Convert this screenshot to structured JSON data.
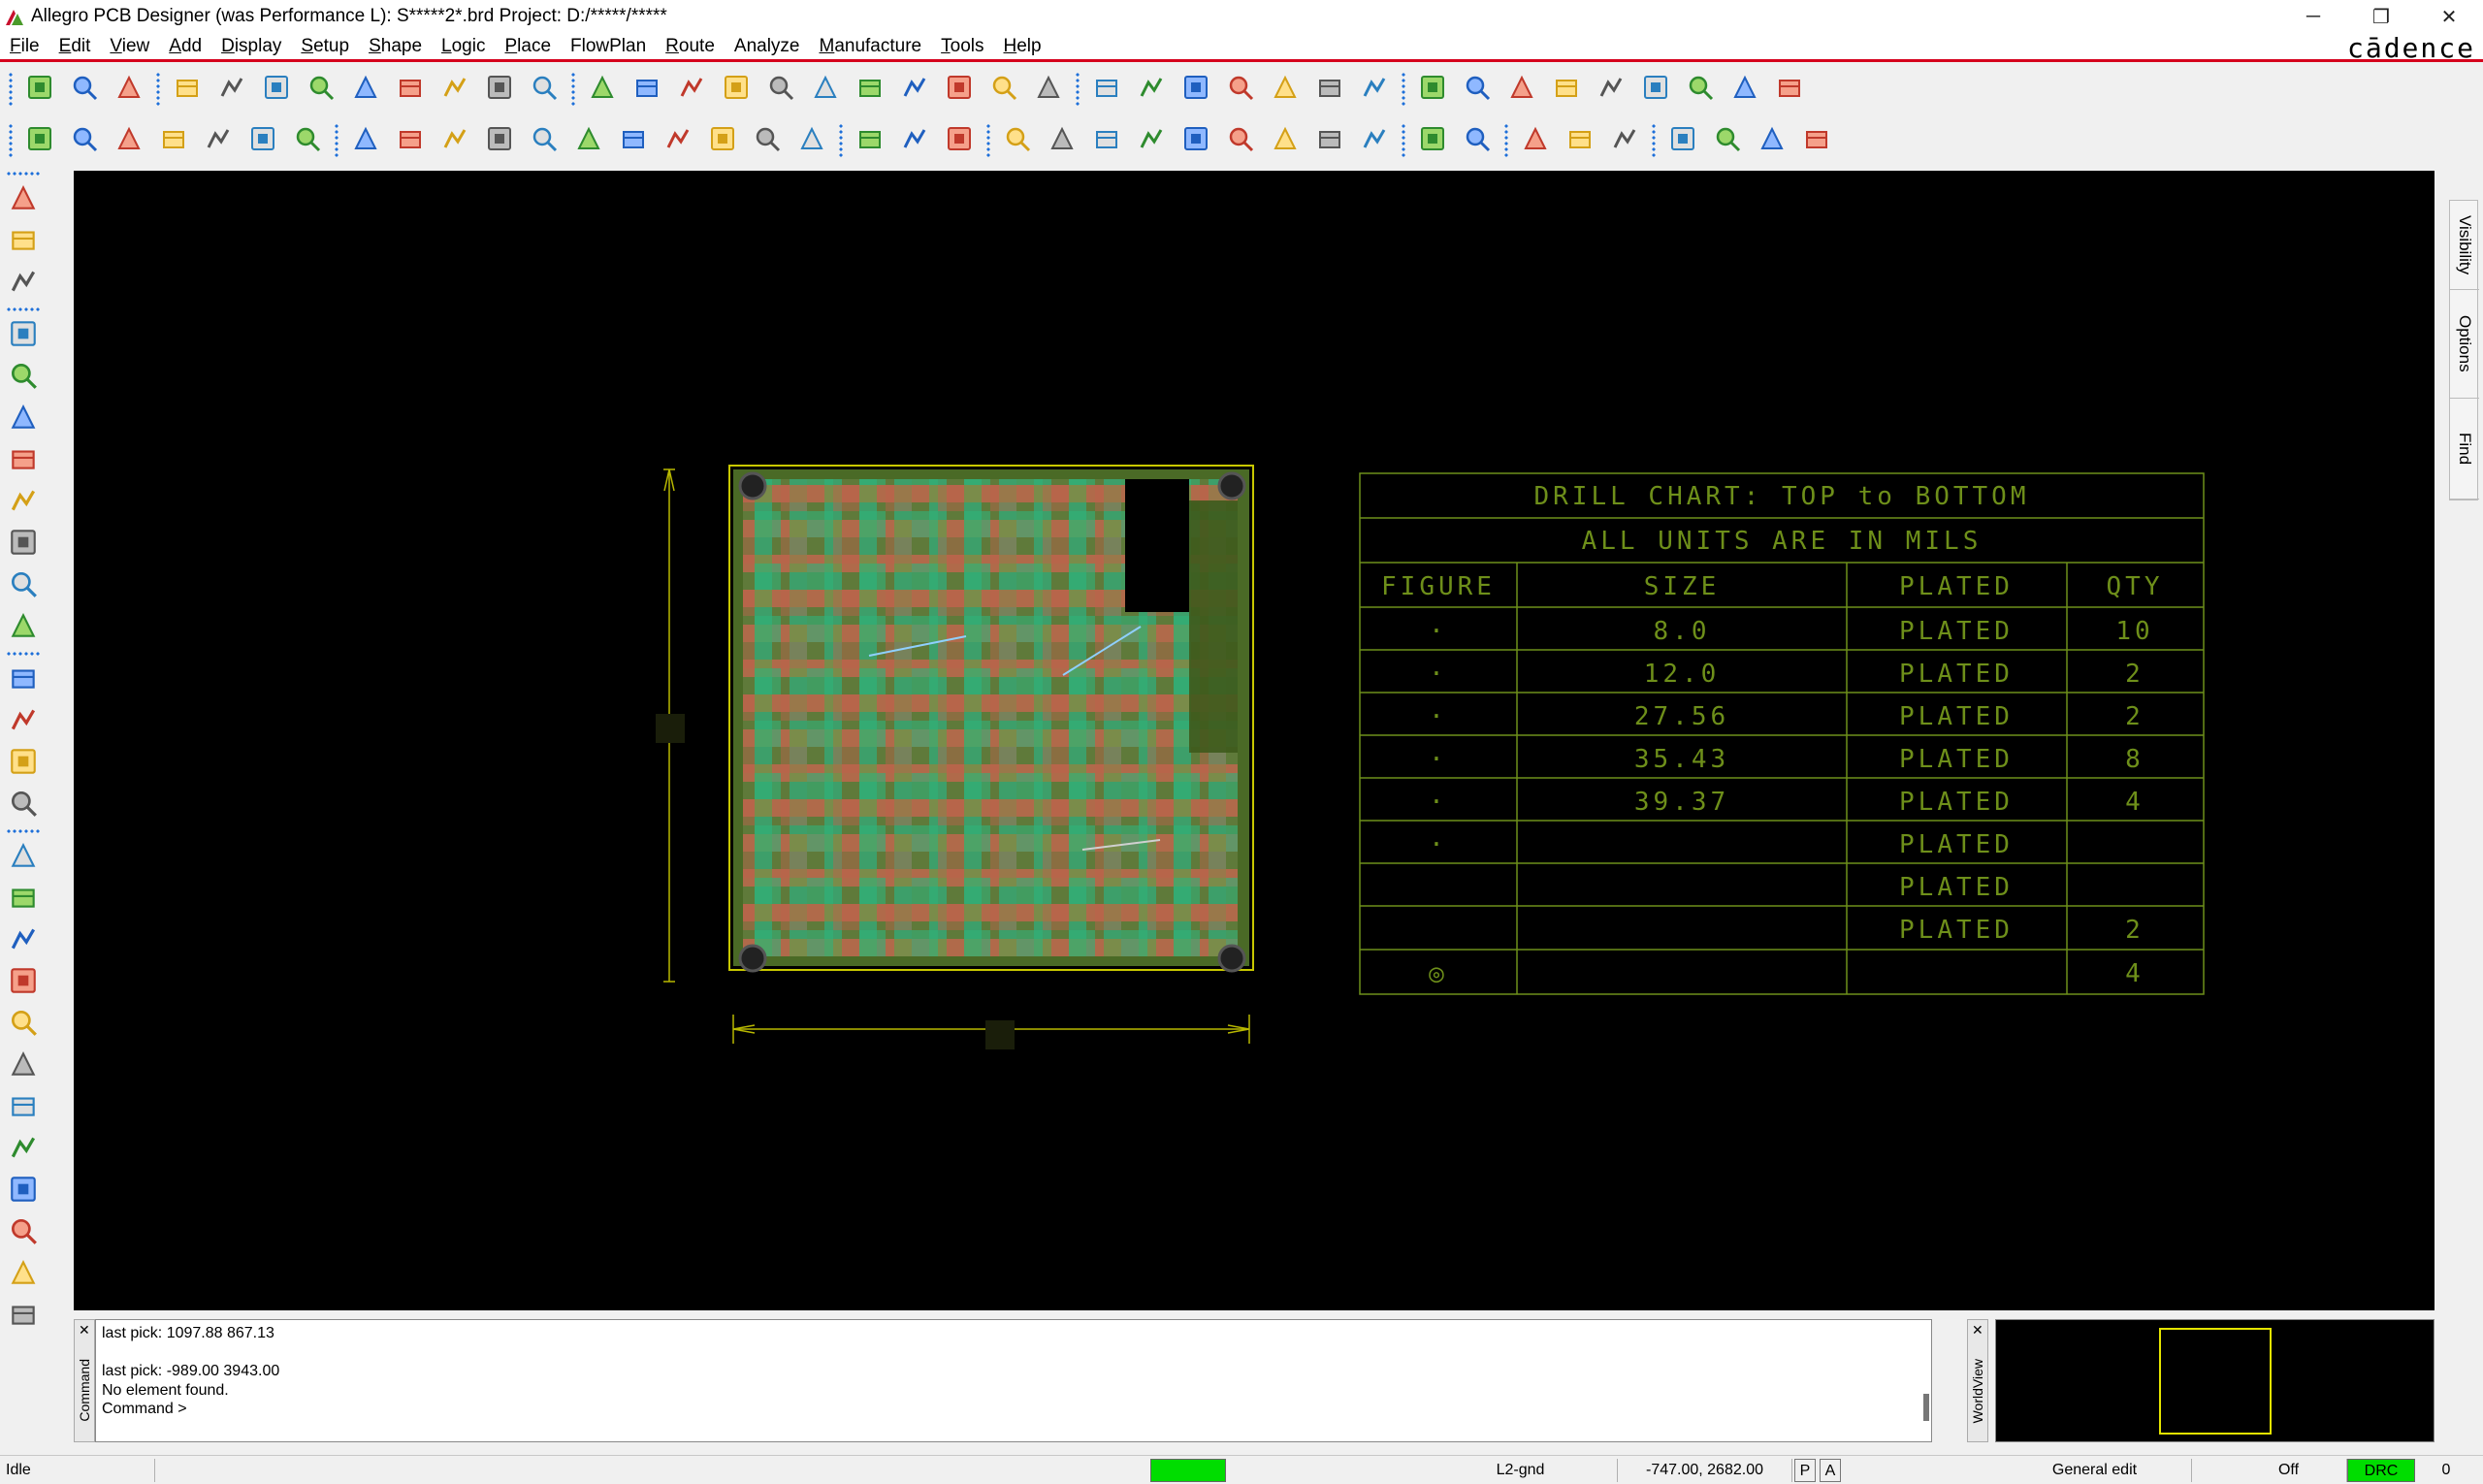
{
  "titlebar": {
    "title": "Allegro PCB Designer (was Performance L): S*****2*.brd  Project: D:/*****/*****",
    "minimize": "─",
    "restore": "❐",
    "close": "✕"
  },
  "menu": {
    "items": [
      {
        "acc": "F",
        "rest": "ile"
      },
      {
        "acc": "E",
        "rest": "dit"
      },
      {
        "acc": "V",
        "rest": "iew"
      },
      {
        "acc": "A",
        "rest": "dd"
      },
      {
        "acc": "D",
        "rest": "isplay"
      },
      {
        "acc": "S",
        "rest": "etup"
      },
      {
        "acc": "S",
        "rest": "hape"
      },
      {
        "acc": "L",
        "rest": "ogic"
      },
      {
        "acc": "P",
        "rest": "lace"
      },
      {
        "acc": "",
        "rest": "FlowPlan"
      },
      {
        "acc": "R",
        "rest": "oute"
      },
      {
        "acc": "",
        "rest": "Analyze"
      },
      {
        "acc": "M",
        "rest": "anufacture"
      },
      {
        "acc": "T",
        "rest": "ools"
      },
      {
        "acc": "H",
        "rest": "elp"
      }
    ],
    "brand": "cādence"
  },
  "sidetabs": {
    "visibility": "Visibility",
    "options": "Options",
    "find": "Find"
  },
  "drill_chart": {
    "title": "DRILL CHART: TOP to BOTTOM",
    "subtitle": "ALL UNITS ARE IN MILS",
    "headers": [
      "FIGURE",
      "SIZE",
      "PLATED",
      "QTY"
    ],
    "rows": [
      [
        "·",
        "8.0",
        "PLATED",
        "10"
      ],
      [
        "·",
        "12.0",
        "PLATED",
        "2"
      ],
      [
        "·",
        "27.56",
        "PLATED",
        "2"
      ],
      [
        "·",
        "35.43",
        "PLATED",
        "8"
      ],
      [
        "·",
        "39.37",
        "PLATED",
        "4"
      ],
      [
        "·",
        "",
        "PLATED",
        ""
      ],
      [
        "",
        "",
        "PLATED",
        ""
      ],
      [
        "",
        "",
        "PLATED",
        "2"
      ],
      [
        "◎",
        "",
        "",
        "4"
      ]
    ]
  },
  "console": {
    "label": "Command",
    "lines": [
      "last pick:  1097.88 867.13",
      "",
      "last pick:  -989.00 3943.00",
      "No element found.",
      "Command >"
    ]
  },
  "worldview": {
    "label": "WorldView"
  },
  "status": {
    "state": "Idle",
    "layer": "L2-gnd",
    "coords": "-747.00, 2682.00",
    "p": "P",
    "a": "A",
    "mode": "General edit",
    "off": "Off",
    "drc": "DRC",
    "count": "0"
  },
  "colors": {
    "accent_red": "#d6001c",
    "board_outline": "#c8c800",
    "chart_green": "#6e8f1a",
    "status_green": "#00dd00"
  },
  "icons": {
    "toolbar1": [
      "new-icon",
      "open-icon",
      "save-icon",
      "move-icon",
      "copy-icon",
      "delete-icon",
      "undo-icon",
      "undo-down-icon",
      "redo-icon",
      "redo-down-icon",
      "add-connect-icon",
      "pin-icon",
      "zoom-window-icon",
      "zoom-grid-icon",
      "zoom-fit-icon",
      "zoom-in-icon",
      "zoom-in2-icon",
      "zoom-out-icon",
      "zoom-prev-icon",
      "zoom-world-icon",
      "refresh-icon",
      "3d-view-icon",
      "flip-icon",
      "grid-icon",
      "color-icon",
      "layer-icon",
      "shape-icon",
      "design-icon",
      "dfa-icon",
      "pcb-icon",
      "info-icon",
      "report-icon",
      "measure-icon",
      "highlight-icon",
      "sun-icon",
      "dehighlight-icon",
      "library-icon",
      "timer-icon",
      "property-icon"
    ],
    "toolbar2": [
      "layer-top-icon",
      "layer-bot-icon",
      "layer-3-icon",
      "layer-4-icon",
      "layer-5-icon",
      "layer-6-icon",
      "layer-7-icon",
      "line-icon",
      "rect-icon",
      "circle-icon",
      "select-icon",
      "arc-icon",
      "arc2-icon",
      "square-icon",
      "circle2-icon",
      "shape-edit-icon",
      "pad-icon",
      "place-icon",
      "dim-h-icon",
      "dim-icon",
      "odb-icon",
      "mirror-icon",
      "spread-icon",
      "camera-icon",
      "properties-icon",
      "book-icon",
      "snap-icon",
      "tune-icon",
      "array-icon",
      "trace-icon",
      "doc1-icon",
      "doc2-icon",
      "doc3-icon",
      "doc4-icon",
      "doc5-icon",
      "window1-icon",
      "window2-icon",
      "window3-icon",
      "help-icon"
    ],
    "left": [
      "place-manual-icon",
      "via-icon",
      "component-icon",
      "route-icon",
      "route2-icon",
      "slide-icon",
      "fanout-icon",
      "delay-tune-icon",
      "bus-icon",
      "matrix-icon",
      "tune-icon",
      "line-draw-icon",
      "rect-draw-icon",
      "text-add-icon",
      "text-edit-icon",
      "trace-1-icon",
      "trace-2-icon",
      "trace-3-icon",
      "trace-4-icon",
      "trace-5-icon",
      "trace-6-icon",
      "trace-7-icon",
      "trace-8-icon",
      "trace-9-icon",
      "trace-10-icon",
      "trace-11-icon",
      "trace-12-icon"
    ]
  }
}
